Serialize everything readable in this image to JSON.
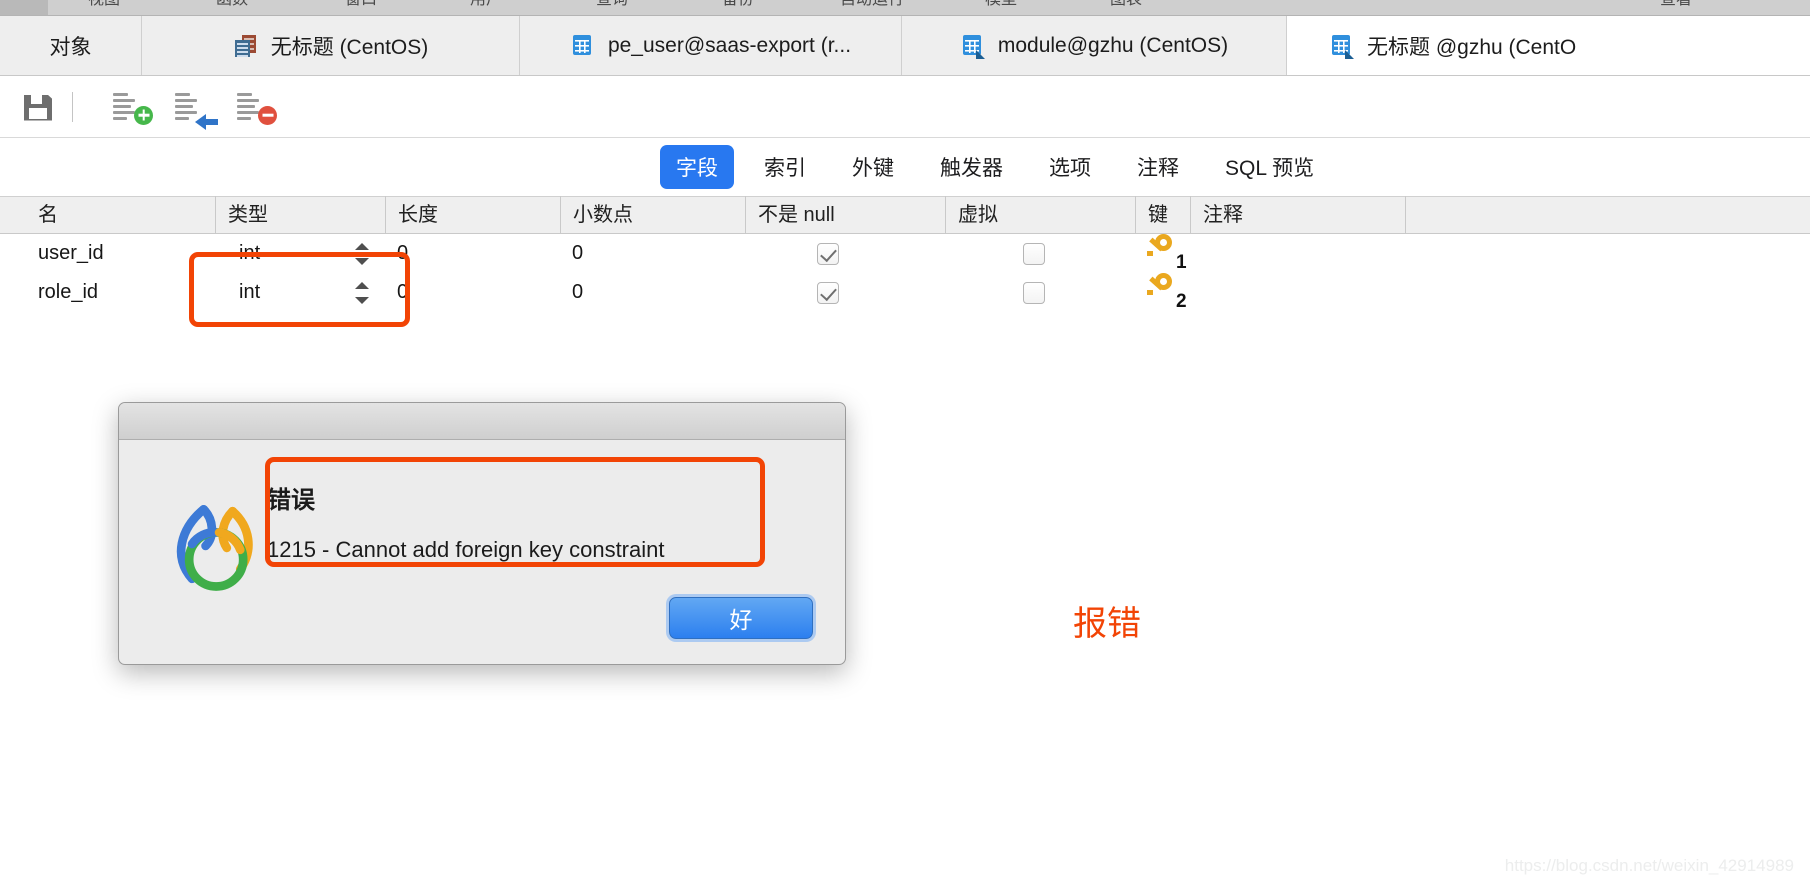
{
  "menubar": {
    "items": [
      "视图",
      "函数",
      "窗口",
      "用户",
      "查询",
      "备份",
      "自动运行",
      "模型",
      "图表"
    ],
    "right_item": "查看"
  },
  "tabstrip": {
    "tabs": [
      {
        "label": "对象",
        "icon": "none",
        "active": false
      },
      {
        "label": "无标题 (CentOS)",
        "icon": "server-icon",
        "active": false
      },
      {
        "label": "pe_user@saas-export (r...",
        "icon": "table-icon",
        "active": false
      },
      {
        "label": "module@gzhu (CentOS)",
        "icon": "table-edit-icon",
        "active": false
      },
      {
        "label": "无标题 @gzhu (CentO",
        "icon": "table-edit-icon",
        "active": true
      }
    ]
  },
  "toolbar": {
    "buttons": [
      {
        "name": "save-button",
        "icon": "floppy-icon",
        "label": "保存"
      },
      {
        "name": "add-field-button",
        "icon": "add-field-icon",
        "label": "添加字段"
      },
      {
        "name": "insert-field-button",
        "icon": "insert-field-icon",
        "label": "插入字段"
      },
      {
        "name": "delete-field-button",
        "icon": "delete-field-icon",
        "label": "删除字段"
      }
    ]
  },
  "inner_tabs": {
    "items": [
      "字段",
      "索引",
      "外键",
      "触发器",
      "选项",
      "注释",
      "SQL 预览"
    ],
    "active": "字段"
  },
  "grid": {
    "columns": [
      "名",
      "类型",
      "长度",
      "小数点",
      "不是 null",
      "虚拟",
      "键",
      "注释"
    ],
    "rows": [
      {
        "name": "user_id",
        "type": "int",
        "length": "0",
        "decimals": "0",
        "not_null": true,
        "virtual": false,
        "key": "1",
        "comment": ""
      },
      {
        "name": "role_id",
        "type": "int",
        "length": "0",
        "decimals": "0",
        "not_null": true,
        "virtual": false,
        "key": "2",
        "comment": ""
      }
    ]
  },
  "dialog": {
    "title": "",
    "message_title": "错误",
    "message_body": "1215 - Cannot add foreign key constraint",
    "ok_label": "好"
  },
  "annotations": {
    "note_label": "报错",
    "accent_color": "#f24405"
  },
  "watermark": "https://blog.csdn.net/weixin_42914989"
}
